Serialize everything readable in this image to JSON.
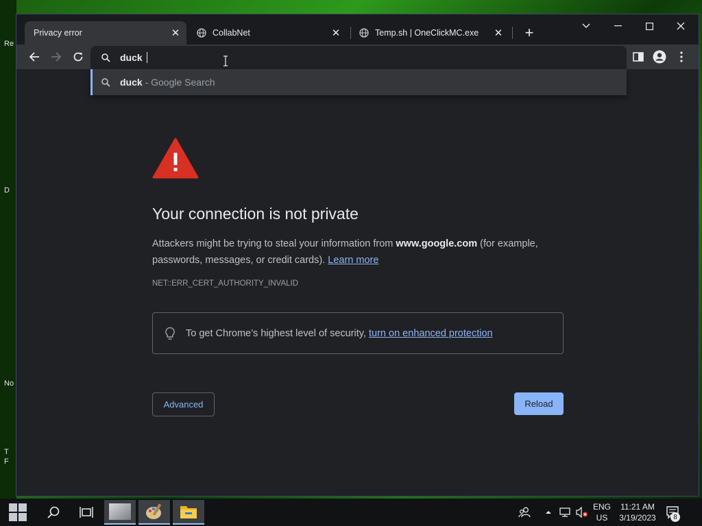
{
  "browser": {
    "tabs": [
      {
        "title": "Privacy error",
        "active": true
      },
      {
        "title": "CollabNet",
        "active": false
      },
      {
        "title": "Temp.sh | OneClickMC.exe",
        "active": false
      }
    ],
    "omnibox": {
      "value": "duck"
    },
    "suggestion": {
      "query": "duck",
      "suffix": " - Google Search"
    }
  },
  "page": {
    "heading": "Your connection is not private",
    "body_prefix": "Attackers might be trying to steal your information from ",
    "domain": "www.google.com",
    "body_suffix": " (for example, passwords, messages, or credit cards).",
    "learn_more": "Learn more",
    "error_code": "NET::ERR_CERT_AUTHORITY_INVALID",
    "protection_prefix": "To get Chrome’s highest level of security,",
    "protection_link": "turn on enhanced protection",
    "advanced_label": "Advanced",
    "reload_label": "Reload"
  },
  "desktop": {
    "labels": [
      "Re",
      "D",
      "No",
      "T",
      "F"
    ]
  },
  "taskbar": {
    "language": "ENG",
    "region": "US",
    "time": "11:21 AM",
    "date": "3/19/2023",
    "notification_count": "8"
  },
  "colors": {
    "accent": "#8ab4f8",
    "warning_red": "#d93025",
    "page_bg": "#202124"
  }
}
